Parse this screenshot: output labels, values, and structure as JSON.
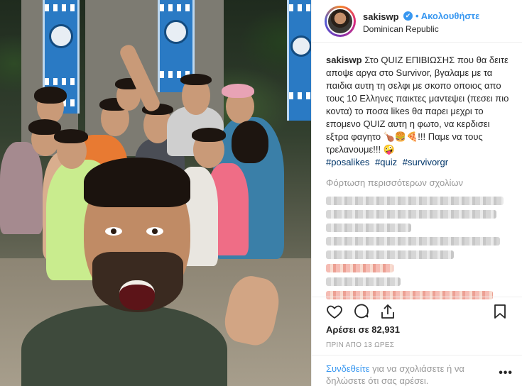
{
  "header": {
    "username": "sakiswp",
    "verified_badge": "✔",
    "follow_label": "Ακολουθήστε",
    "follow_separator": "•",
    "location": "Dominican Republic"
  },
  "caption": {
    "username": "sakiswp",
    "text": "Στο QUIZ ΕΠΙΒΙΩΣΗΣ που θα δειτε αποψε αργα στο Survivor, βγαλαμε με τα παιδια αυτη τη σελφι με σκοπο οποιος απο τους 10 Ελληνες παικτες μαντεψει (πεσει πιο κοντα) το ποσα likes θα παρει μεχρι το επομενο QUIZ αυτη η φωτο, να κερδισει εξτρα φαγητο 🍗🍔🍕!!! Παμε να τους τρελανουμε!!! 🤪",
    "hashtags": [
      "#posalikes",
      "#quiz",
      "#survivorgr"
    ]
  },
  "load_more_label": "Φόρτωση περισσότερων σχολίων",
  "actions": {
    "like_icon": "heart-outline-icon",
    "comment_icon": "comment-bubble-icon",
    "share_icon": "share-arrow-icon",
    "save_icon": "bookmark-icon"
  },
  "likes_text": "Αρέσει σε 82,931",
  "timestamp": "ΠΡΙΝ ΑΠΟ 13 ΩΡΕΣ",
  "footer": {
    "login_link": "Συνδεθείτε",
    "login_rest": " για να σχολιάσετε ή να δηλώσετε ότι σας αρέσει.",
    "more_icon": "more-options-icon",
    "more_glyph": "•••"
  },
  "colors": {
    "accent_blue": "#3897f0",
    "hashtag_blue": "#003569",
    "muted_gray": "#999999",
    "text": "#262626"
  }
}
